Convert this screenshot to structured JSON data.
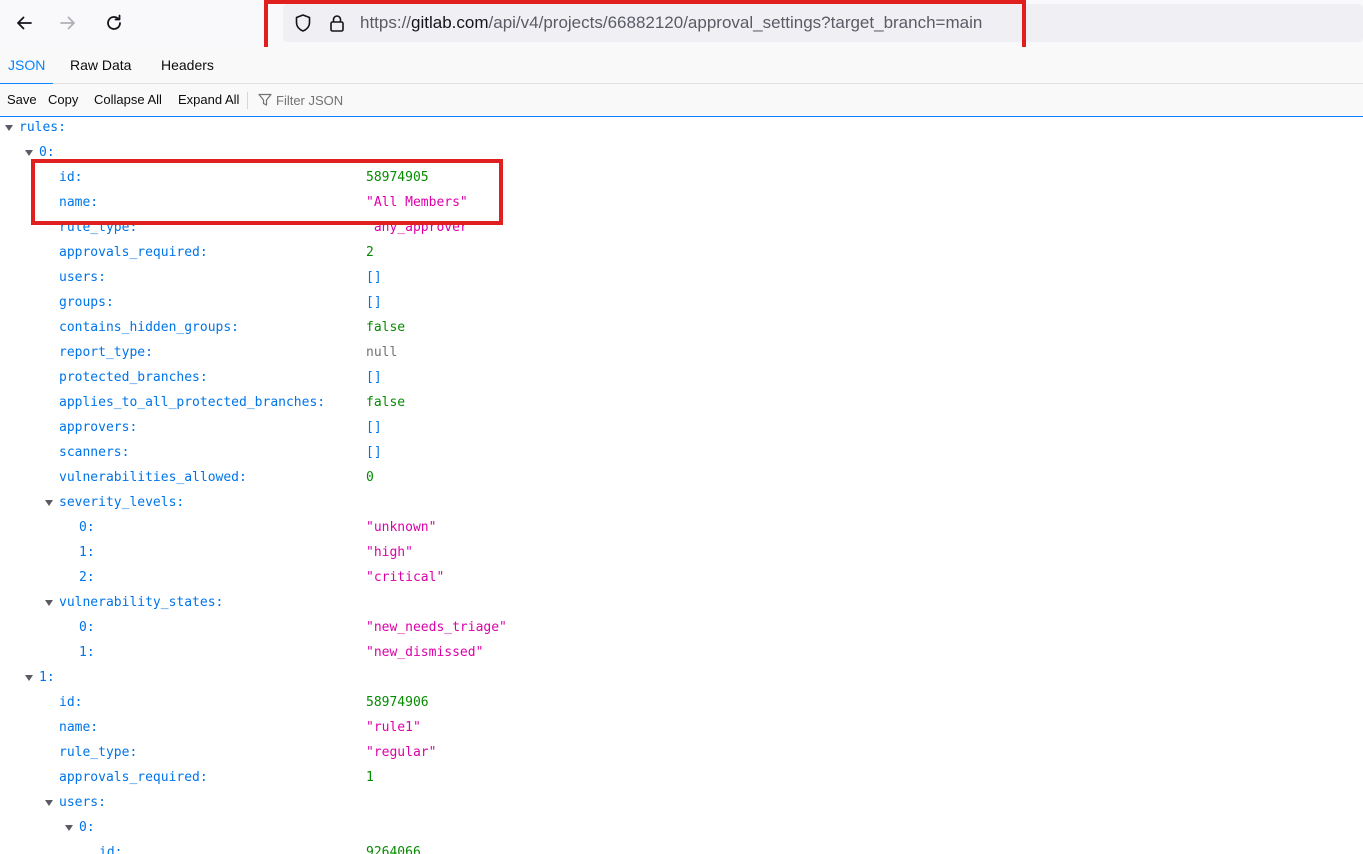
{
  "browser": {
    "url": {
      "scheme": "https://",
      "host": "gitlab.com",
      "path": "/api/v4/projects/66882120/approval_settings?target_branch=main"
    }
  },
  "viewer": {
    "tabs": [
      {
        "label": "JSON",
        "active": true
      },
      {
        "label": "Raw Data",
        "active": false
      },
      {
        "label": "Headers",
        "active": false
      }
    ],
    "toolbar": {
      "save": "Save",
      "copy": "Copy",
      "collapse_all": "Collapse All",
      "expand_all": "Expand All",
      "filter_placeholder": "Filter JSON"
    }
  },
  "colors": {
    "key": "#0074e8",
    "number": "#058b00",
    "string": "#dd00a9",
    "highlight": "#e0201f",
    "accent": "#0a84ff"
  },
  "json_rows": [
    {
      "key": "rules:",
      "depth": 0,
      "toggle": true
    },
    {
      "key": "0:",
      "depth": 1,
      "toggle": true
    },
    {
      "key": "id:",
      "depth": 2,
      "value": "58974905",
      "type": "num"
    },
    {
      "key": "name:",
      "depth": 2,
      "value": "\"All Members\"",
      "type": "str"
    },
    {
      "key": "rule_type:",
      "depth": 2,
      "value": "\"any_approver\"",
      "type": "str"
    },
    {
      "key": "approvals_required:",
      "depth": 2,
      "value": "2",
      "type": "num"
    },
    {
      "key": "users:",
      "depth": 2,
      "value": "[]",
      "type": "arr"
    },
    {
      "key": "groups:",
      "depth": 2,
      "value": "[]",
      "type": "arr"
    },
    {
      "key": "contains_hidden_groups:",
      "depth": 2,
      "value": "false",
      "type": "bool"
    },
    {
      "key": "report_type:",
      "depth": 2,
      "value": "null",
      "type": "null"
    },
    {
      "key": "protected_branches:",
      "depth": 2,
      "value": "[]",
      "type": "arr"
    },
    {
      "key": "applies_to_all_protected_branches:",
      "depth": 2,
      "value": "false",
      "type": "bool"
    },
    {
      "key": "approvers:",
      "depth": 2,
      "value": "[]",
      "type": "arr"
    },
    {
      "key": "scanners:",
      "depth": 2,
      "value": "[]",
      "type": "arr"
    },
    {
      "key": "vulnerabilities_allowed:",
      "depth": 2,
      "value": "0",
      "type": "num"
    },
    {
      "key": "severity_levels:",
      "depth": 2,
      "toggle": true
    },
    {
      "key": "0:",
      "depth": 3,
      "value": "\"unknown\"",
      "type": "str"
    },
    {
      "key": "1:",
      "depth": 3,
      "value": "\"high\"",
      "type": "str"
    },
    {
      "key": "2:",
      "depth": 3,
      "value": "\"critical\"",
      "type": "str"
    },
    {
      "key": "vulnerability_states:",
      "depth": 2,
      "toggle": true
    },
    {
      "key": "0:",
      "depth": 3,
      "value": "\"new_needs_triage\"",
      "type": "str"
    },
    {
      "key": "1:",
      "depth": 3,
      "value": "\"new_dismissed\"",
      "type": "str"
    },
    {
      "key": "1:",
      "depth": 1,
      "toggle": true
    },
    {
      "key": "id:",
      "depth": 2,
      "value": "58974906",
      "type": "num"
    },
    {
      "key": "name:",
      "depth": 2,
      "value": "\"rule1\"",
      "type": "str"
    },
    {
      "key": "rule_type:",
      "depth": 2,
      "value": "\"regular\"",
      "type": "str"
    },
    {
      "key": "approvals_required:",
      "depth": 2,
      "value": "1",
      "type": "num"
    },
    {
      "key": "users:",
      "depth": 2,
      "toggle": true
    },
    {
      "key": "0:",
      "depth": 3,
      "toggle": true
    },
    {
      "key": "id:",
      "depth": 4,
      "value": "9264066",
      "type": "num"
    }
  ]
}
